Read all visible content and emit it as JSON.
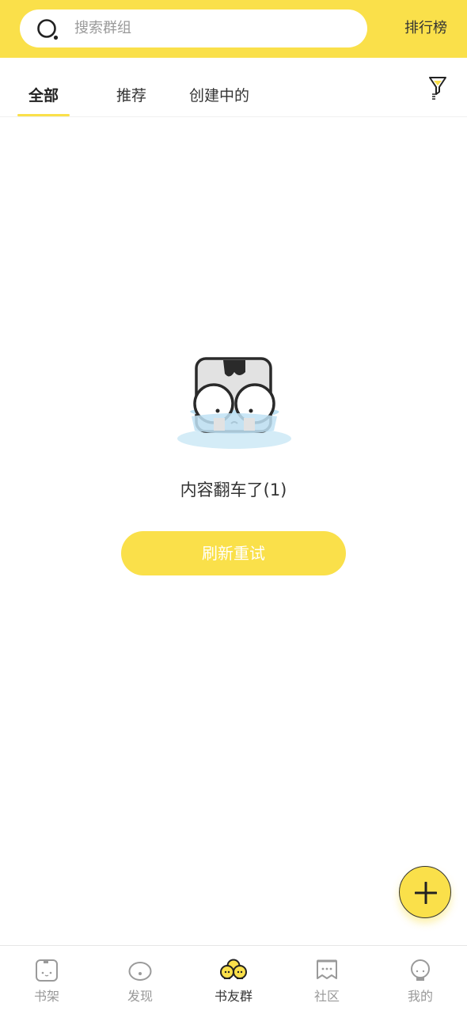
{
  "header": {
    "search_placeholder": "搜索群组",
    "rank_label": "排行榜"
  },
  "tabs": [
    {
      "label": "全部",
      "active": true
    },
    {
      "label": "推荐",
      "active": false
    },
    {
      "label": "创建中的",
      "active": false
    }
  ],
  "empty_state": {
    "message": "内容翻车了(1)",
    "retry_label": "刷新重试"
  },
  "bottom_nav": [
    {
      "label": "书架",
      "icon": "bookshelf-icon",
      "active": false
    },
    {
      "label": "发现",
      "icon": "discover-icon",
      "active": false
    },
    {
      "label": "书友群",
      "icon": "book-friends-group-icon",
      "active": true
    },
    {
      "label": "社区",
      "icon": "community-icon",
      "active": false
    },
    {
      "label": "我的",
      "icon": "profile-icon",
      "active": false
    }
  ],
  "colors": {
    "accent": "#fae04a",
    "text": "#333333",
    "muted": "#999999"
  }
}
